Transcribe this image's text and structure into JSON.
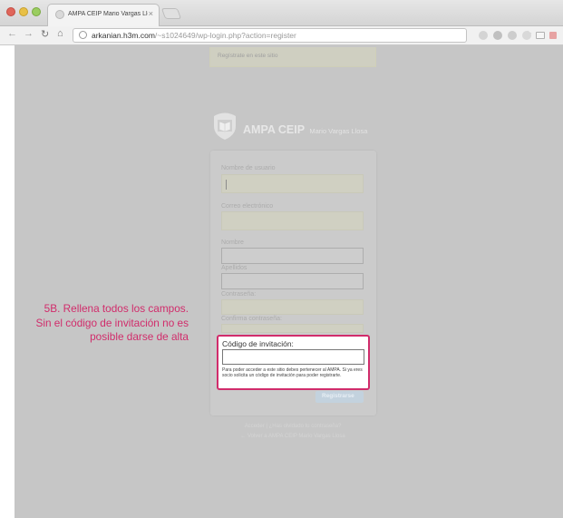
{
  "browser": {
    "tab_title": "AMPA CEIP Mario Vargas Llo",
    "tab_close": "×",
    "url_host": "arkanian.h3m.com",
    "url_path": "/~s1024649/wp-login.php?action=register"
  },
  "page": {
    "message": "Regístrate en este sitio",
    "logo": {
      "title": "AMPA CEIP",
      "subtitle": "Mario Vargas Llosa"
    },
    "form": {
      "username_label": "Nombre de usuario",
      "email_label": "Correo electrónico",
      "name_label": "Nombre",
      "surname_label": "Apellidos",
      "password_label": "Contraseña:",
      "confirm_label": "Confirma contraseña:",
      "invite_label": "Código de invitación:",
      "invite_help": "Para poder acceder a este sitio debes pertenecer al AMPA. Si ya eres socio solicita un código de invitación para poder registrarte.",
      "submit_label": "Registrarse"
    },
    "footer_links": {
      "line1": "Acceder | ¿Has olvidado tu contraseña?",
      "line2": "← Volver a AMPA CEIP Mario Vargas Llosa"
    }
  },
  "annotation": {
    "line1": "5B. Rellena todos los campos.",
    "line2": "Sin el código de invitación no es",
    "line3": "posible darse de alta"
  },
  "colors": {
    "accent": "#d12c6b",
    "overlay": "#c6c6c6"
  }
}
